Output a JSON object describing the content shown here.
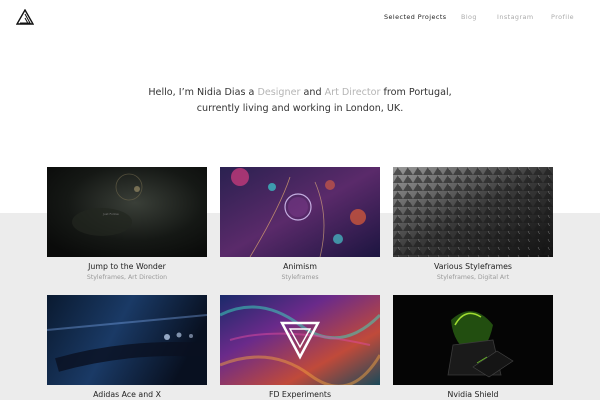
{
  "nav": {
    "items": [
      {
        "label": "Selected Projects",
        "active": true
      },
      {
        "label": "Blog",
        "active": false
      },
      {
        "label": "Instagram",
        "active": false
      },
      {
        "label": "Profile",
        "active": false
      }
    ]
  },
  "intro": {
    "part1": "Hello, I’m Nidia Dias a ",
    "highlight1": "Designer",
    "part2": " and ",
    "highlight2": "Art Director",
    "part3": " from Portugal,",
    "line2": "currently living and working in London, UK."
  },
  "projects": [
    {
      "title": "Jump to the Wonder",
      "subtitle": "Styleframes, Art Direction",
      "thumb_caption": "Just Follow"
    },
    {
      "title": "Animism",
      "subtitle": "Styleframes"
    },
    {
      "title": "Various Styleframes",
      "subtitle": "Styleframes, Digital Art"
    },
    {
      "title": "Adidas Ace and X",
      "subtitle": ""
    },
    {
      "title": "FD Experiments",
      "subtitle": ""
    },
    {
      "title": "Nvidia Shield",
      "subtitle": ""
    }
  ],
  "colors": {
    "accent_highlight": "#b5b5b5",
    "band": "#ececec"
  }
}
